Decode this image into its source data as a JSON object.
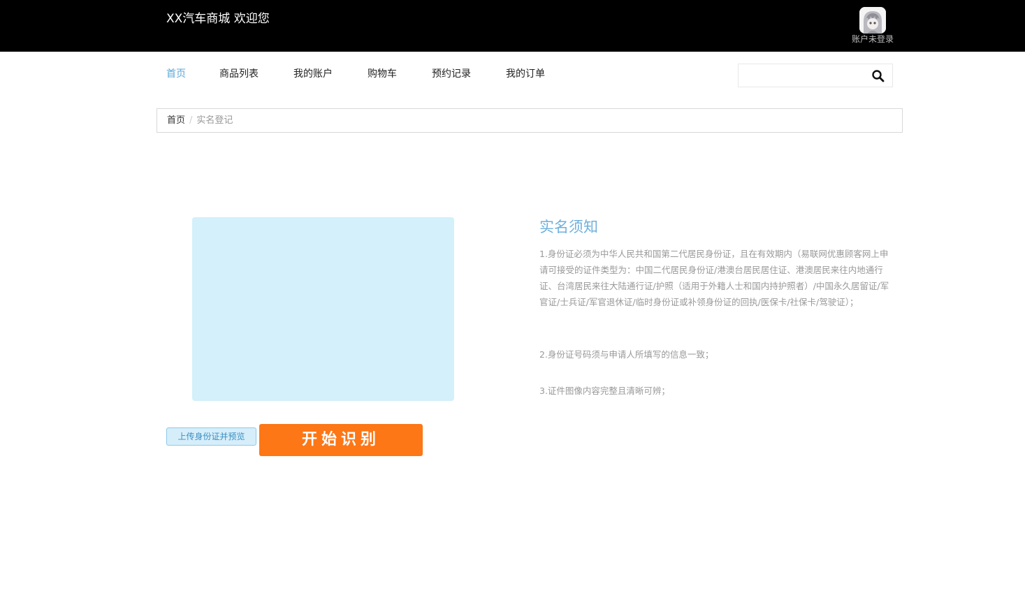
{
  "header": {
    "site_title": "XX汽车商城 欢迎您",
    "user_status": "账户未登录"
  },
  "nav": {
    "items": [
      {
        "label": "首页",
        "active": true
      },
      {
        "label": "商品列表",
        "active": false
      },
      {
        "label": "我的账户",
        "active": false
      },
      {
        "label": "购物车",
        "active": false
      },
      {
        "label": "预约记录",
        "active": false
      },
      {
        "label": "我的订单",
        "active": false
      }
    ]
  },
  "search": {
    "value": "",
    "placeholder": "",
    "icon": "search-icon"
  },
  "breadcrumb": {
    "home": "首页",
    "separator": "/",
    "current": "实名登记"
  },
  "upload": {
    "upload_label": "上传身份证并预览",
    "recognize_label": "开始识别"
  },
  "notice": {
    "title": "实名须知",
    "items": [
      "1.身份证必须为中华人民共和国第二代居民身份证，且在有效期内（易联网优惠顾客网上申请可接受的证件类型为：中国二代居民身份证/港澳台居民居住证、港澳居民来往内地通行证、台湾居民来往大陆通行证/护照（适用于外籍人士和国内持护照者）/中国永久居留证/军官证/士兵证/军官退休证/临时身份证或补领身份证的回执/医保卡/社保卡/驾驶证）；",
      "2.身份证号码须与申请人所填写的信息一致；",
      "3.证件图像内容完整且清晰可辨；"
    ]
  },
  "colors": {
    "topbar": "#000000",
    "nav_active": "#5aa7d6",
    "notice_title": "#6fb0de",
    "preview_bg": "#d3f0fb",
    "upload_bg": "#d6eefa",
    "recognize_bg": "#fd7716"
  }
}
